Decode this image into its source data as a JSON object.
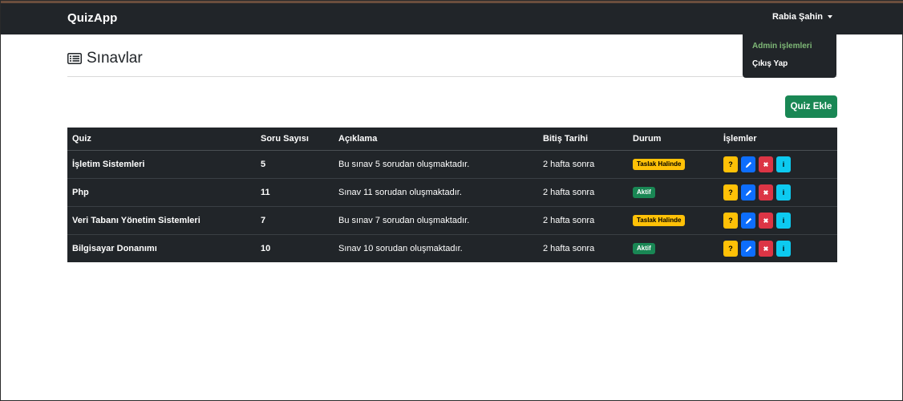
{
  "navbar": {
    "brand": "QuizApp",
    "user": "Rabia Şahin"
  },
  "dropdown": {
    "items": [
      "Admin işlemleri",
      "Çıkış Yap"
    ]
  },
  "page": {
    "title": "Sınavlar",
    "add_button": "Quiz Ekle"
  },
  "table": {
    "headers": [
      "Quiz",
      "Soru Sayısı",
      "Açıklama",
      "Bitiş Tarihi",
      "Durum",
      "İşlemler"
    ],
    "rows": [
      {
        "quiz": "İşletim Sistemleri",
        "count": "5",
        "desc": "Bu sınav 5 sorudan oluşmaktadır.",
        "end": "2 hafta sonra",
        "status": "Taslak Halinde",
        "status_type": "taslak"
      },
      {
        "quiz": "Php",
        "count": "11",
        "desc": "Sınav 11 sorudan oluşmaktadır.",
        "end": "2 hafta sonra",
        "status": "Aktif",
        "status_type": "aktif"
      },
      {
        "quiz": "Veri Tabanı Yönetim Sistemleri",
        "count": "7",
        "desc": "Bu sınav 7 sorudan oluşmaktadır.",
        "end": "2 hafta sonra",
        "status": "Taslak Halinde",
        "status_type": "taslak"
      },
      {
        "quiz": "Bilgisayar Donanımı",
        "count": "10",
        "desc": "Sınav 10 sorudan oluşmaktadır.",
        "end": "2 hafta sonra",
        "status": "Aktif",
        "status_type": "aktif"
      }
    ]
  },
  "icons": {
    "heading": "list-icon",
    "actions": [
      "question-icon",
      "pencil-icon",
      "close-icon",
      "info-icon"
    ]
  },
  "colors": {
    "navbar": "#212529",
    "success": "#198754",
    "warning": "#ffc107",
    "primary": "#0d6efd",
    "danger": "#dc3545",
    "info": "#0dcaf0"
  }
}
